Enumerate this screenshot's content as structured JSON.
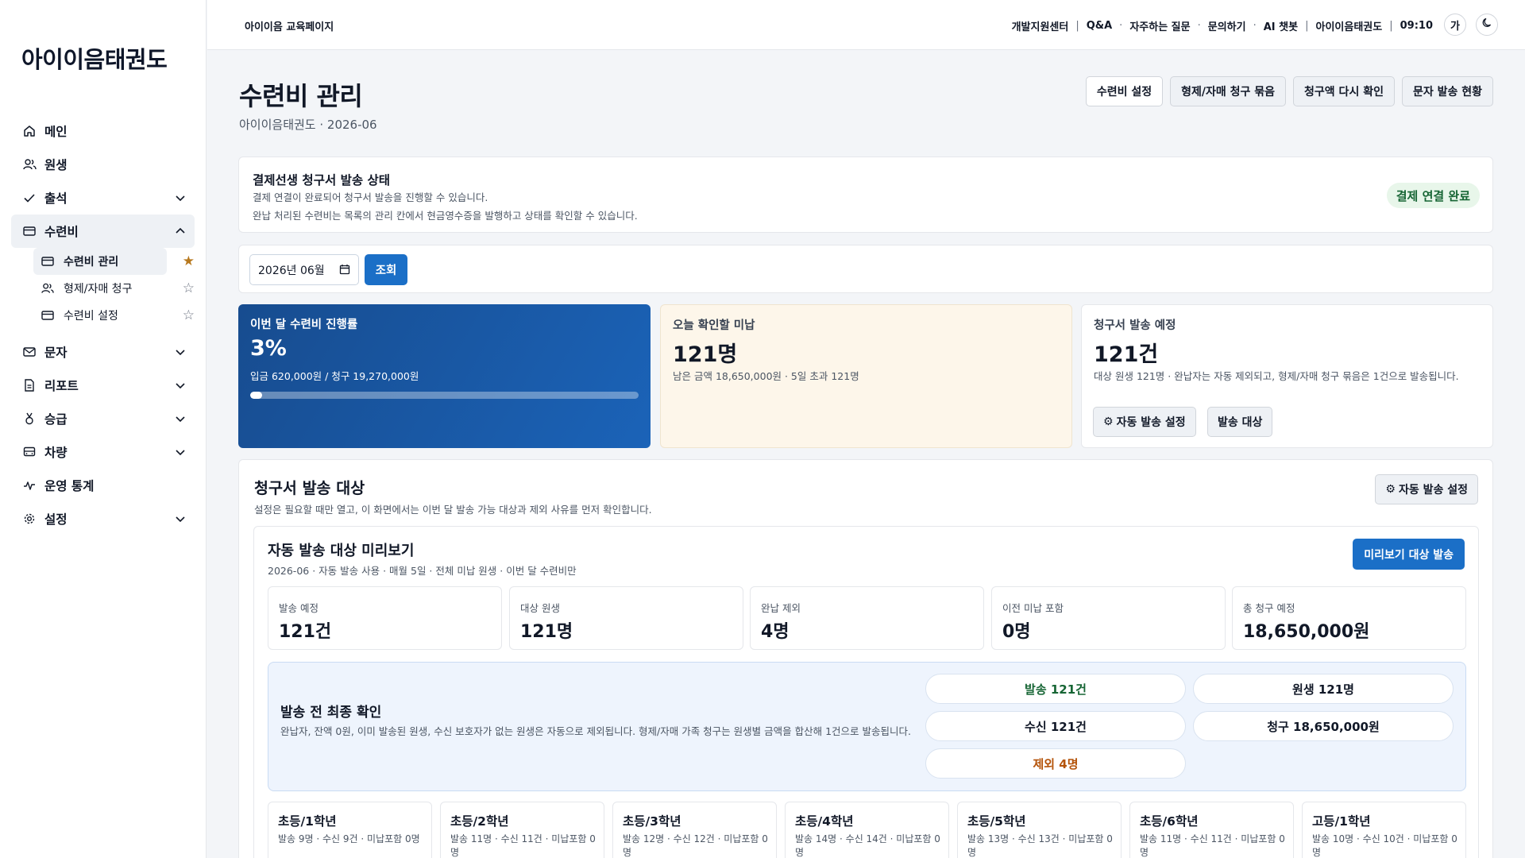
{
  "sidebar": {
    "logo": "아이이음태권도",
    "items": [
      {
        "label": "메인"
      },
      {
        "label": "원생"
      },
      {
        "label": "출석"
      },
      {
        "label": "수련비"
      },
      {
        "label": "문자"
      },
      {
        "label": "리포트"
      },
      {
        "label": "승급"
      },
      {
        "label": "차량"
      },
      {
        "label": "운영 통계"
      },
      {
        "label": "설정"
      }
    ],
    "sub_items": [
      {
        "label": "수련비 관리"
      },
      {
        "label": "형제/자매 청구"
      },
      {
        "label": "수련비 설정"
      }
    ]
  },
  "topbar": {
    "brand": "아이이음 교육페이지",
    "links": [
      "개발지원센터",
      "Q&A",
      "자주하는 질문",
      "문의하기",
      "AI 챗봇",
      "아이이음태권도",
      "09:10"
    ],
    "seps": [
      "|",
      "·",
      "·",
      "·",
      "|",
      "|"
    ],
    "font_btn": "가"
  },
  "page": {
    "title": "수련비 관리",
    "subtitle": "아이이음태권도 · 2026-06",
    "buttons": [
      "수련비 설정",
      "형제/자매 청구 묶음",
      "청구액 다시 확인",
      "문자 발송 현황"
    ]
  },
  "status": {
    "title": "결제선생 청구서 발송 상태",
    "line1": "결제 연결이 완료되어 청구서 발송을 진행할 수 있습니다.",
    "line2": "완납 처리된 수련비는 목록의 관리 칸에서 현금영수증을 발행하고 상태를 확인할 수 있습니다.",
    "badge": "결제 연결 완료"
  },
  "filter": {
    "month": "2026년 06월",
    "search": "조회"
  },
  "kpi": {
    "progress": {
      "label": "이번 달 수련비 진행률",
      "value": "3%",
      "sub": "입금 620,000원 / 청구 19,270,000원",
      "ratio": 0.03
    },
    "unpaid": {
      "label": "오늘 확인할 미납",
      "value": "121명",
      "sub": "남은 금액 18,650,000원 · 5일 초과 121명"
    },
    "invoice": {
      "label": "청구서 발송 예정",
      "value": "121건",
      "sub": "대상 원생 121명 · 완납자는 자동 제외되고, 형제/자매 청구 묶음은 1건으로 발송됩니다.",
      "auto_btn": "자동 발송 설정",
      "target_btn": "발송 대상"
    }
  },
  "send": {
    "title": "청구서 발송 대상",
    "subtitle": "설정은 필요할 때만 열고, 이 화면에서는 이번 달 발송 가능 대상과 제외 사유를 먼저 확인합니다.",
    "auto_btn": "자동 발송 설정",
    "preview": {
      "title": "자동 발송 대상 미리보기",
      "subtitle": "2026-06 · 자동 발송 사용 · 매월 5일 · 전체 미납 원생 · 이번 달 수련비만",
      "send_btn": "미리보기 대상 발송",
      "stats": [
        {
          "label": "발송 예정",
          "value": "121건"
        },
        {
          "label": "대상 원생",
          "value": "121명"
        },
        {
          "label": "완납 제외",
          "value": "4명"
        },
        {
          "label": "이전 미납 포함",
          "value": "0명"
        },
        {
          "label": "총 청구 예정",
          "value": "18,650,000원"
        }
      ],
      "final": {
        "title": "발송 전 최종 확인",
        "desc": "완납자, 잔액 0원, 이미 발송된 원생, 수신 보호자가 없는 원생은 자동으로 제외됩니다. 형제/자매 가족 청구는 원생별 금액을 합산해 1건으로 발송됩니다.",
        "pills": [
          "발송 121건",
          "원생 121명",
          "수신 121건",
          "청구 18,650,000원",
          "제외 4명"
        ]
      },
      "grades": [
        {
          "title": "초등/1학년",
          "sub": "발송 9명 · 수신 9건 · 미납포함 0명"
        },
        {
          "title": "초등/2학년",
          "sub": "발송 11명 · 수신 11건 · 미납포함 0명"
        },
        {
          "title": "초등/3학년",
          "sub": "발송 12명 · 수신 12건 · 미납포함 0명"
        },
        {
          "title": "초등/4학년",
          "sub": "발송 14명 · 수신 14건 · 미납포함 0명"
        },
        {
          "title": "초등/5학년",
          "sub": "발송 13명 · 수신 13건 · 미납포함 0명"
        },
        {
          "title": "초등/6학년",
          "sub": "발송 11명 · 수신 11건 · 미납포함 0명"
        },
        {
          "title": "고등/1학년",
          "sub": "발송 10명 · 수신 10건 · 미납포함 0명"
        }
      ]
    }
  },
  "colors": {
    "primary": "#1b6fc7",
    "success": "#166534",
    "warning": "#b45309",
    "star_active": "#b7791f"
  }
}
